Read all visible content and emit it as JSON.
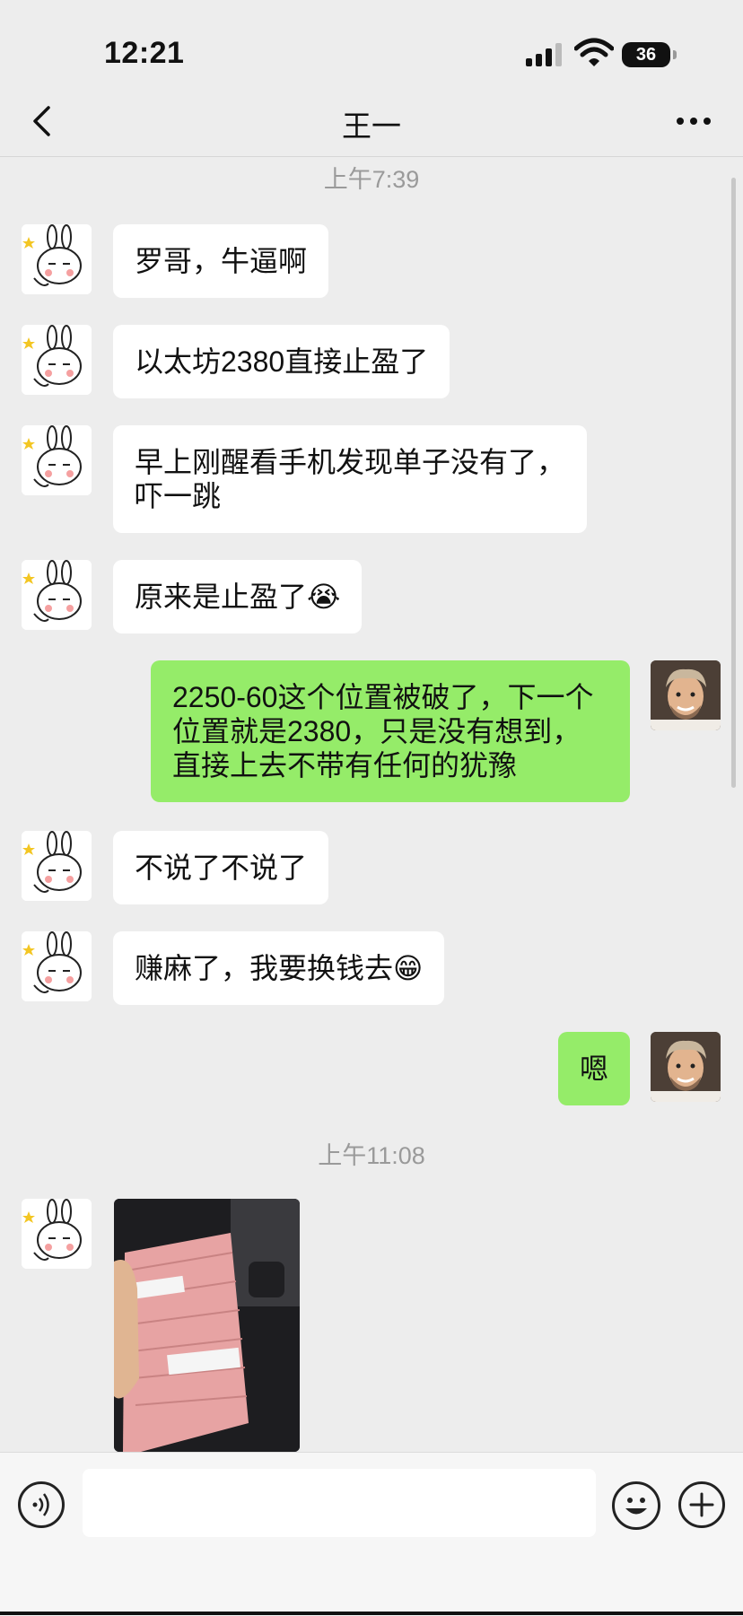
{
  "status_bar": {
    "time": "12:21",
    "battery": "36"
  },
  "header": {
    "title": "王一"
  },
  "timestamps": [
    "上午7:39",
    "上午11:08"
  ],
  "messages": [
    {
      "from": "them",
      "text": "罗哥，牛逼啊"
    },
    {
      "from": "them",
      "text": "以太坊2380直接止盈了"
    },
    {
      "from": "them",
      "text": "早上刚醒看手机发现单子没有了，吓一跳"
    },
    {
      "from": "them",
      "text": "原来是止盈了😭"
    },
    {
      "from": "me",
      "text": "2250-60这个位置被破了，下一个位置就是2380，只是没有想到，直接上去不带有任何的犹豫"
    },
    {
      "from": "them",
      "text": "不说了不说了"
    },
    {
      "from": "them",
      "text": "赚麻了，我要换钱去😁"
    },
    {
      "from": "me",
      "text": "嗯"
    },
    {
      "from": "them",
      "type": "image",
      "icon": "photo-of-cash"
    }
  ],
  "colors": {
    "background": "#ededed",
    "bubble_in": "#ffffff",
    "bubble_out": "#95ec69"
  },
  "input_bar": {
    "placeholder": ""
  }
}
